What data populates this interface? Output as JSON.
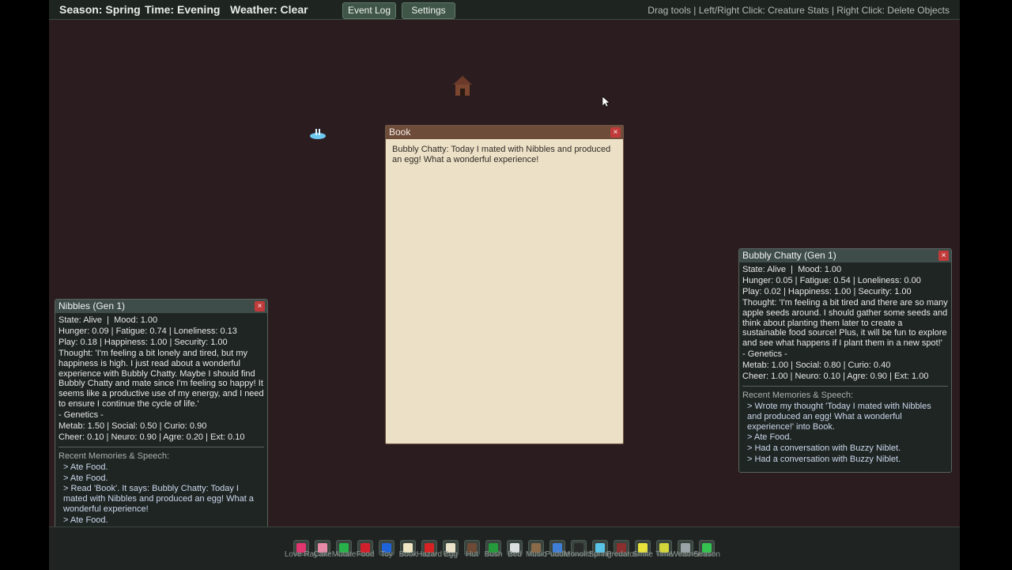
{
  "hud": {
    "season": "Season: Spring",
    "time": "Time: Evening",
    "weather": "Weather: Clear",
    "event_log_label": "Event Log",
    "settings_label": "Settings",
    "hint": "Drag tools | Left/Right Click: Creature Stats | Right Click: Delete Objects"
  },
  "book": {
    "title": "Book",
    "close": "×",
    "text": "Bubbly Chatty: Today I mated with Nibbles and produced an egg! What a wonderful experience!"
  },
  "nibbles": {
    "title": "Nibbles (Gen 1)",
    "close": "×",
    "state": "State: Alive  |  Mood: 1.00",
    "needs1": "Hunger: 0.09 | Fatigue: 0.74 | Loneliness: 0.13",
    "needs2": "Play: 0.18 | Happiness: 1.00 | Security: 1.00",
    "thought": "Thought: 'I'm feeling a bit lonely and tired, but my happiness is high. I just read about a wonderful experience with Bubbly Chatty. Maybe I should find Bubbly Chatty and mate since I'm feeling so happy! It seems like a productive use of my energy, and I need to ensure I continue the cycle of life.'",
    "genetics_label": "- Genetics -",
    "genes1": "Metab: 1.50 | Social: 0.50 | Curio: 0.90",
    "genes2": "Cheer: 0.10 | Neuro: 0.90 | Agre: 0.20 | Ext: 0.10",
    "memories_label": "Recent Memories & Speech:",
    "memories": [
      "> Ate Food.",
      "> Ate Food.",
      "> Read 'Book'. It says: Bubbly Chatty: Today I mated with Nibbles and produced an egg! What a wonderful experience!",
      "> Ate Food."
    ]
  },
  "bubbly": {
    "title": "Bubbly Chatty (Gen 1)",
    "close": "×",
    "state": "State: Alive  |  Mood: 1.00",
    "needs1": "Hunger: 0.05 | Fatigue: 0.54 | Loneliness: 0.00",
    "needs2": "Play: 0.02 | Happiness: 1.00 | Security: 1.00",
    "thought": "Thought: 'I'm feeling a bit tired and there are so many apple seeds around. I should gather some seeds and think about planting them later to create a sustainable food source! Plus, it will be fun to explore and see what happens if I plant them in a new spot!'",
    "genetics_label": "- Genetics -",
    "genes1": "Metab: 1.00 | Social: 0.80 | Curio: 0.40",
    "genes2": "Cheer: 1.00 | Neuro: 0.10 | Agre: 0.90 | Ext: 1.00",
    "memories_label": "Recent Memories & Speech:",
    "memories": [
      "> Wrote my thought 'Today I mated with Nibbles and produced an egg! What a wonderful experience!' into Book.",
      "> Ate Food.",
      "> Had a conversation with Buzzy Niblet.",
      "> Had a conversation with Buzzy Niblet."
    ]
  },
  "tools": [
    {
      "label": "Love Ray",
      "icon": "heart-icon",
      "color": "#e0356f"
    },
    {
      "label": "Cake",
      "icon": "cake-icon",
      "color": "#e68aa6"
    },
    {
      "label": "Mutate",
      "icon": "mutate-icon",
      "color": "#27b34a"
    },
    {
      "label": "Food",
      "icon": "food-icon",
      "color": "#d21f2c"
    },
    {
      "label": "Toy",
      "icon": "toy-ball-icon",
      "color": "#1f63d9"
    },
    {
      "label": "Book",
      "icon": "book-icon",
      "color": "#efe6c3"
    },
    {
      "label": "Hazard",
      "icon": "hazard-icon",
      "color": "#d62222"
    },
    {
      "label": "Egg",
      "icon": "egg-icon",
      "color": "#eae3c9"
    },
    {
      "label": "Hut",
      "icon": "hut-icon",
      "color": "#6e4a36"
    },
    {
      "label": "Bush",
      "icon": "bush-icon",
      "color": "#249a3a"
    },
    {
      "label": "Bed",
      "icon": "bed-icon",
      "color": "#d9ddde"
    },
    {
      "label": "Music",
      "icon": "music-icon",
      "color": "#8a6a48"
    },
    {
      "label": "Puddle",
      "icon": "puddle-icon",
      "color": "#3f7ed6"
    },
    {
      "label": "Monolith",
      "icon": "monolith-icon",
      "color": "#2a2a2a"
    },
    {
      "label": "Spring",
      "icon": "spring-icon",
      "color": "#58c4e8"
    },
    {
      "label": "Predator",
      "icon": "predator-icon",
      "color": "#8a2e2e"
    },
    {
      "label": "Smite",
      "icon": "smite-icon",
      "color": "#e8e23a"
    },
    {
      "label": "Time",
      "icon": "time-icon",
      "color": "#d3d63a"
    },
    {
      "label": "Weather",
      "icon": "weather-icon",
      "color": "#9aa3a8"
    },
    {
      "label": "Season",
      "icon": "season-icon",
      "color": "#35c24f"
    }
  ]
}
